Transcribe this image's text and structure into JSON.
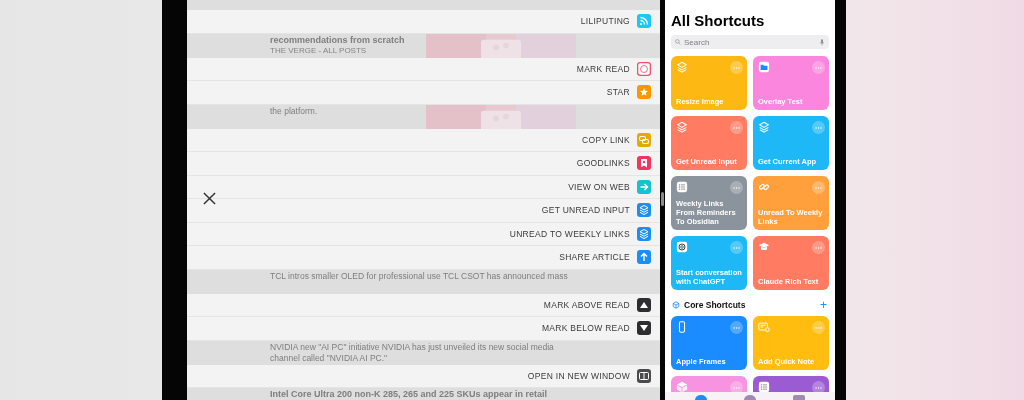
{
  "left_pane": {
    "sections": [
      {
        "kind": "article"
      },
      {
        "kind": "menu",
        "items": [
          {
            "label": "LILIPUTING",
            "kind": "rss",
            "color": "#1ec6f2"
          }
        ]
      },
      {
        "kind": "article",
        "image": {
          "kind": "picture"
        },
        "lines": [
          {
            "kind": "title",
            "text": "recommendations from scratch"
          },
          {
            "kind": "source",
            "text": "THE VERGE - ALL POSTS"
          }
        ]
      },
      {
        "kind": "menu",
        "items": [
          {
            "label": "MARK READ",
            "kind": "circle",
            "color": "#f0506a"
          },
          {
            "label": "STAR",
            "kind": "star",
            "color": "#ff9500"
          }
        ]
      },
      {
        "kind": "article",
        "image": {
          "kind": "picture"
        },
        "lines": [
          {
            "kind": "body",
            "text": "the platform."
          }
        ]
      },
      {
        "kind": "menu",
        "items": [
          {
            "label": "COPY LINK",
            "kind": "copy",
            "color": "#e3aa00"
          },
          {
            "label": "GOODLINKS",
            "kind": "bookmark",
            "color": "#f5335f"
          },
          {
            "label": "VIEW ON WEB",
            "kind": "forward",
            "color": "#14c3cf"
          },
          {
            "label": "GET UNREAD INPUT",
            "kind": "layers",
            "color": "#1a8ff5"
          },
          {
            "label": "UNREAD TO WEEKLY LINKS",
            "kind": "layers",
            "color": "#1a8ff5"
          },
          {
            "label": "SHARE ARTICLE",
            "kind": "share",
            "color": "#1a8ff5"
          }
        ]
      },
      {
        "kind": "article",
        "lines": [
          {
            "kind": "body",
            "text": "TCL intros smaller OLED for professional use TCL CSOT has announced mass"
          }
        ]
      },
      {
        "kind": "menu",
        "items": [
          {
            "label": "MARK ABOVE READ",
            "kind": "above",
            "color": "#2e2e30"
          },
          {
            "label": "MARK BELOW READ",
            "kind": "below",
            "color": "#2e2e30"
          }
        ]
      },
      {
        "kind": "article",
        "lines": [
          {
            "kind": "body",
            "text": "NVIDIA new \"AI PC\" initiative NVIDIA has just unveiled its new social media"
          },
          {
            "kind": "body",
            "text": "channel called \"NVIDIA AI PC.\""
          }
        ]
      },
      {
        "kind": "menu",
        "items": [
          {
            "label": "OPEN IN NEW WINDOW",
            "kind": "window",
            "color": "#4a4a4e"
          }
        ]
      },
      {
        "kind": "article",
        "lines": [
          {
            "kind": "title",
            "text": "Intel Core Ultra 200 non-K 285, 265 and 225 SKUs appear in retail"
          }
        ]
      }
    ]
  },
  "right_pane": {
    "title": "All Shortcuts",
    "search": {
      "placeholder": "Search"
    },
    "shortcuts": [
      {
        "name": "Resize Image",
        "color": "#fdb813",
        "kind": "layers"
      },
      {
        "name": "Overlay Test",
        "color": "#fb86de",
        "kind": "folder"
      },
      {
        "name": "Get Unread Input",
        "color": "#ff7b62",
        "kind": "layers"
      },
      {
        "name": "Get Current App",
        "color": "#1db8f5",
        "kind": "layers"
      },
      {
        "name": "Weekly Links From Reminders To Obsidian",
        "color": "#8b949d",
        "kind": "list"
      },
      {
        "name": "Unread To Weekly Links",
        "color": "#ffa03c",
        "kind": "link"
      },
      {
        "name": "Start conversation with ChatGPT",
        "color": "#1db8f5",
        "kind": "chat"
      },
      {
        "name": "Claude Rich Text",
        "color": "#ff7b62",
        "kind": "cap"
      }
    ],
    "section": {
      "title": "Core Shortcuts",
      "add": "+"
    },
    "core_shortcuts": [
      {
        "name": "Apple Frames",
        "color": "#1a8cff",
        "kind": "phone"
      },
      {
        "name": "Add Quick Note",
        "color": "#ffbd10",
        "kind": "note"
      },
      {
        "color": "#f793e0",
        "kind": "box"
      },
      {
        "color": "#9b5bd3",
        "kind": "list"
      }
    ]
  }
}
